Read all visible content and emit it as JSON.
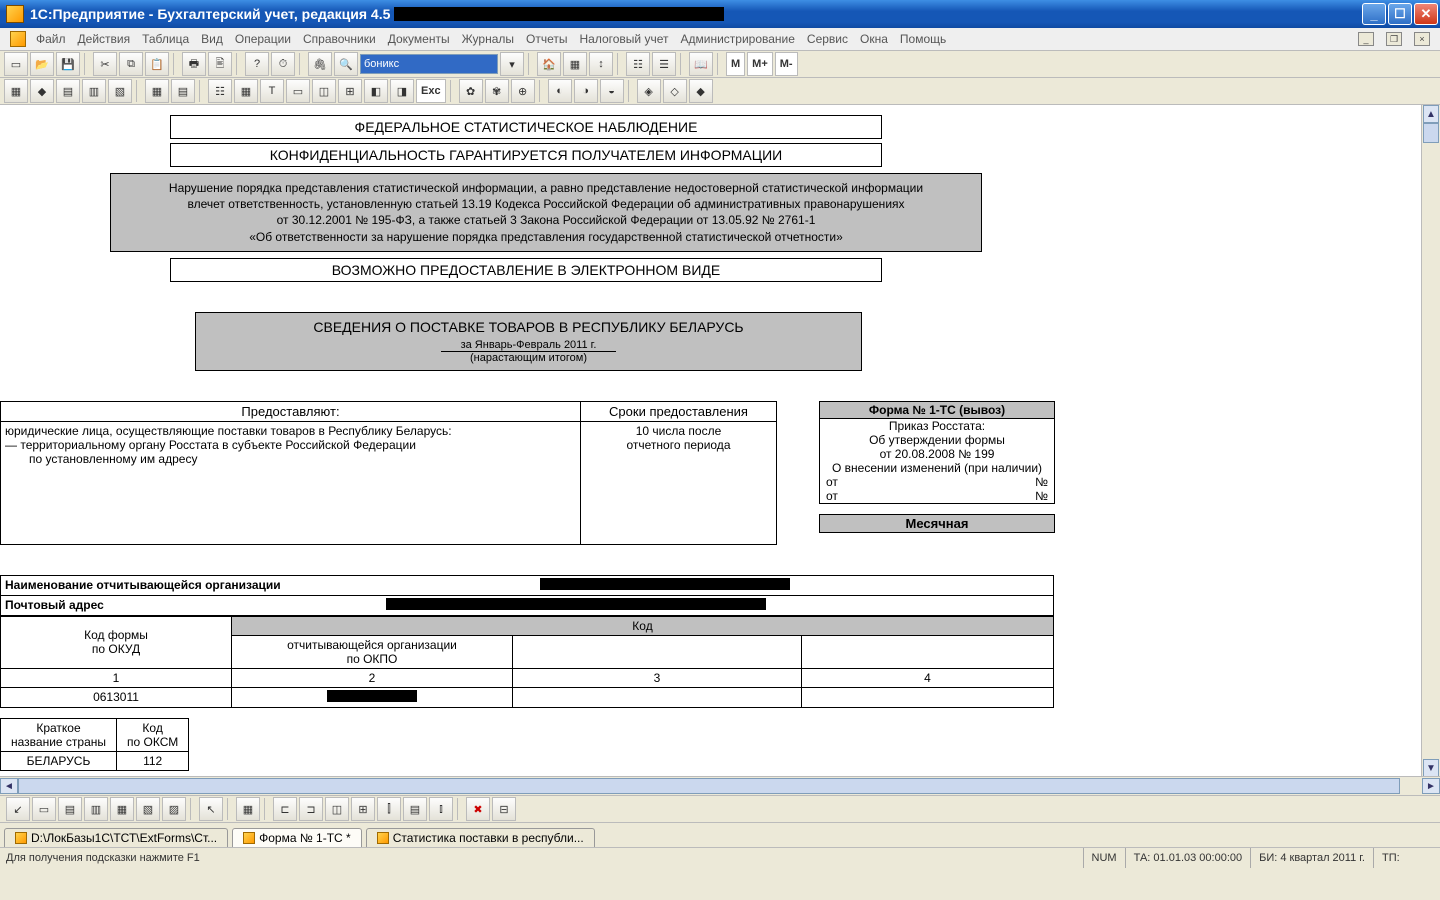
{
  "title": "1С:Предприятие - Бухгалтерский учет, редакция 4.5",
  "menu": [
    "Файл",
    "Действия",
    "Таблица",
    "Вид",
    "Операции",
    "Справочники",
    "Документы",
    "Журналы",
    "Отчеты",
    "Налоговый учет",
    "Администрирование",
    "Сервис",
    "Окна",
    "Помощь"
  ],
  "toolbar1": {
    "search_value": "боникс",
    "m_buttons": [
      "M",
      "M+",
      "M-"
    ]
  },
  "report": {
    "h1": "ФЕДЕРАЛЬНОЕ СТАТИСТИЧЕСКОЕ НАБЛЮДЕНИЕ",
    "h2": "КОНФИДЕНЦИАЛЬНОСТЬ ГАРАНТИРУЕТСЯ ПОЛУЧАТЕЛЕМ ИНФОРМАЦИИ",
    "note_l1": "Нарушение порядка представления статистической информации, а равно представление недостоверной статистической информации",
    "note_l2": "влечет ответственность, установленную статьей 13.19 Кодекса Российской Федерации об административных правонарушениях",
    "note_l3": "от 30.12.2001 № 195-ФЗ, а также статьей 3 Закона Российской Федерации от 13.05.92 № 2761-1",
    "note_l4": "«Об ответственности за нарушение порядка представления государственной статистической отчетности»",
    "h3": "ВОЗМОЖНО ПРЕДОСТАВЛЕНИЕ В ЭЛЕКТРОННОМ ВИДЕ",
    "title": "СВЕДЕНИЯ О ПОСТАВКЕ ТОВАРОВ В РЕСПУБЛИКУ БЕЛАРУСЬ",
    "period": "за Январь-Февраль  2011 г.",
    "period_sub": "(нарастающим итогом)",
    "left_header1": "Предоставляют:",
    "left_header2": "Сроки предоставления",
    "left_body_l1": "юридические лица, осуществляющие поставки товаров в Республику Беларусь:",
    "left_body_l2": "— территориальному органу Росстата в субъекте Российской Федерации",
    "left_body_l3": "по установленному им адресу",
    "left_body_r1": "10 числа после",
    "left_body_r2": "отчетного периода",
    "form_header": "Форма № 1-ТС (вывоз)",
    "form_l1": "Приказ Росстата:",
    "form_l2": "Об утверждении формы",
    "form_l3": "от 20.08.2008 № 199",
    "form_l4": "О внесении изменений (при наличии)",
    "form_l5_left": "от",
    "form_l5_right": "№",
    "form_l6_left": "от",
    "form_l6_right": "№",
    "monthly": "Месячная",
    "org_name_lbl": "Наименование отчитывающейся организации",
    "org_addr_lbl": "Почтовый адрес",
    "code_head1_l1": "Код формы",
    "code_head1_l2": "по ОКУД",
    "code_top": "Код",
    "code_head2_l1": "отчитывающейся организации",
    "code_head2_l2": "по ОКПО",
    "cols": [
      "1",
      "2",
      "3",
      "4"
    ],
    "okud": "0613011",
    "country_head1_l1": "Краткое",
    "country_head1_l2": "название страны",
    "country_head2_l1": "Код",
    "country_head2_l2": "по ОКСМ",
    "country": "БЕЛАРУСЬ",
    "country_code": "112"
  },
  "tabs": [
    {
      "label": "D:\\ЛокБазы1С\\ТСТ\\ExtForms\\Ст...",
      "active": false
    },
    {
      "label": "Форма № 1-ТС  *",
      "active": true
    },
    {
      "label": "Статистика поставки в республи...",
      "active": false
    }
  ],
  "status": {
    "hint": "Для получения подсказки нажмите F1",
    "num": "NUM",
    "ta": "ТА: 01.01.03  00:00:00",
    "bi": "БИ: 4 квартал 2011 г.",
    "tp": "ТП:"
  }
}
